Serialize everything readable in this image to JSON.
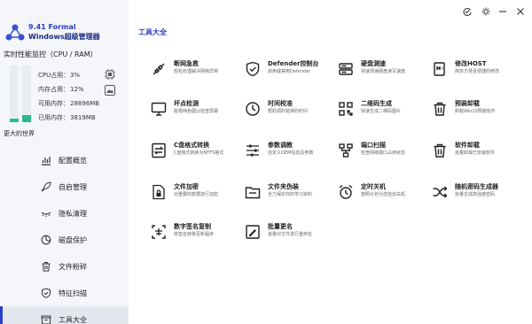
{
  "app": {
    "version": "9.41 Formal",
    "name": "Windows超级管理器"
  },
  "monitor": {
    "title": "实时性能监控（CPU / RAM）",
    "cpu_percent": 3,
    "ram_percent": 12,
    "stats": [
      {
        "label": "CPU占用：",
        "value": "3%"
      },
      {
        "label": "内存占用：",
        "value": "12%"
      },
      {
        "label": "可用内存：",
        "value": "28896MB"
      },
      {
        "label": "已用内存：",
        "value": "3819MB"
      }
    ]
  },
  "sidebar": {
    "section_label": "更大的世界",
    "items": [
      {
        "label": "配置概览",
        "icon": "chart-icon"
      },
      {
        "label": "自启管理",
        "icon": "rocket-icon"
      },
      {
        "label": "隐私清理",
        "icon": "eye-closed-icon"
      },
      {
        "label": "磁盘保护",
        "icon": "pie-chart-icon"
      },
      {
        "label": "文件粉碎",
        "icon": "trash-icon"
      },
      {
        "label": "特征扫描",
        "icon": "shield-check-icon"
      },
      {
        "label": "工具大全",
        "icon": "box-icon",
        "active": true
      }
    ]
  },
  "main": {
    "title": "工具大全"
  },
  "tools": [
    {
      "name": "断网急救",
      "desc": "轻松处理解决网络异常",
      "icon": "plug-icon"
    },
    {
      "name": "Defender控制台",
      "desc": "启用或禁用Defender",
      "icon": "shield-check-icon"
    },
    {
      "name": "硬盘测速",
      "desc": "快速测速硬盘读写速度",
      "icon": "hard-drive-icon"
    },
    {
      "name": "修改HOST",
      "desc": "简单方便且便捷的修改",
      "icon": "hosts-file-icon"
    },
    {
      "name": "坏点检测",
      "desc": "能根纯色图以检查屏幕",
      "icon": "monitor-icon"
    },
    {
      "name": "时间校准",
      "desc": "帮助调的错误的时间",
      "icon": "clock-icon"
    },
    {
      "name": "二维码生成",
      "desc": "快速生成二维码图片",
      "icon": "qr-code-icon"
    },
    {
      "name": "预装卸载",
      "desc": "卸载Win10预装软件",
      "icon": "trash-icon"
    },
    {
      "name": "C盘格式转换",
      "desc": "C盘格式转换为NTFS格式",
      "icon": "swap-icon"
    },
    {
      "name": "参数调教",
      "desc": "自定义OEM信息及参数",
      "icon": "sliders-icon"
    },
    {
      "name": "端口扫描",
      "desc": "检查网络端口占用状态",
      "icon": "network-icon"
    },
    {
      "name": "软件卸载",
      "desc": "批量卸载已安装软件",
      "icon": "trash-icon"
    },
    {
      "name": "文件加密",
      "desc": "对重要的数据进行加密",
      "icon": "lock-file-icon"
    },
    {
      "name": "文件夹伪装",
      "desc": "全力保护你的学习资料",
      "icon": "folder-icon"
    },
    {
      "name": "定时关机",
      "desc": "按照计划为您自动关机",
      "icon": "alarm-icon"
    },
    {
      "name": "随机密码生成器",
      "desc": "批量生成高强度密码",
      "icon": "shuffle-icon"
    },
    {
      "name": "数字签名复制",
      "desc": "将签名转移至新程序",
      "icon": "signature-icon"
    },
    {
      "name": "批量更名",
      "desc": "批量对文件进行重命名",
      "icon": "rename-icon"
    }
  ],
  "colors": {
    "accent": "#2a3fc8",
    "bar_fill": "#2bba8a",
    "sidebar_bg": "#f4f6f9"
  }
}
